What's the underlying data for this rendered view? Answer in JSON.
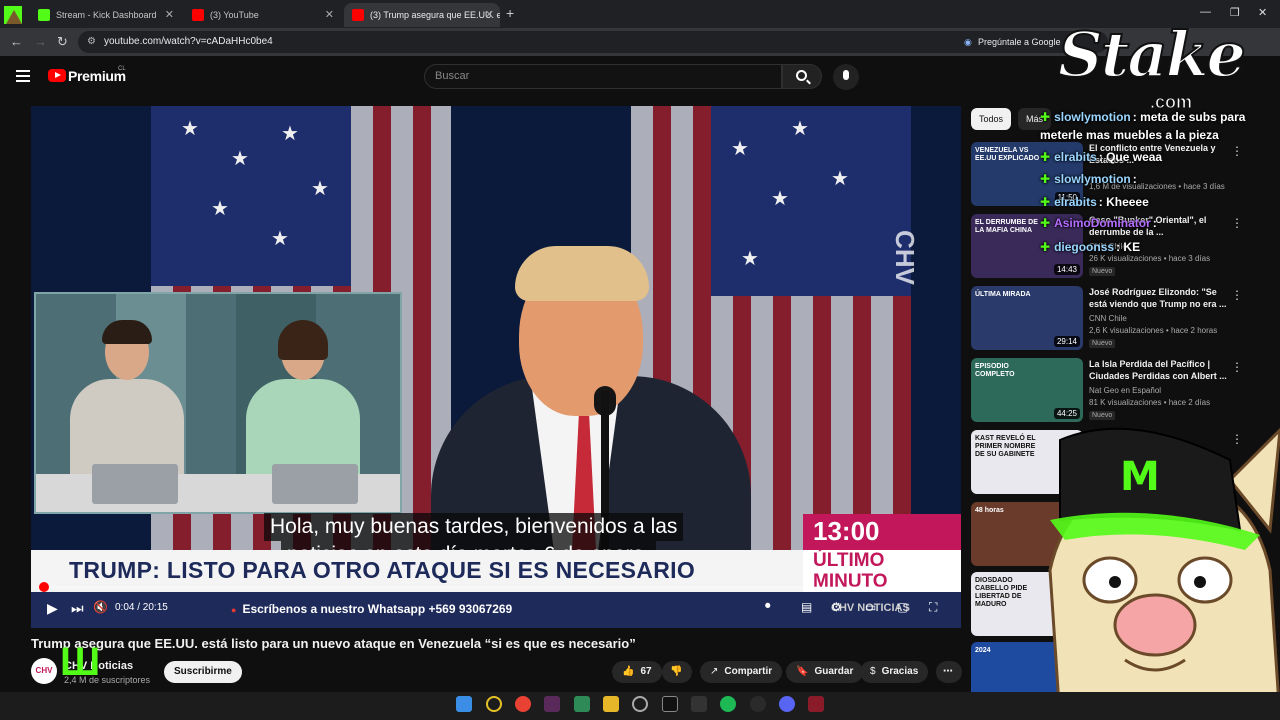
{
  "browser": {
    "tabs": [
      {
        "label": "Stream - Kick Dashboard",
        "active": false
      },
      {
        "label": "(3) YouTube",
        "active": false
      },
      {
        "label": "(3) Trump asegura que EE.UU. e",
        "active": true
      }
    ],
    "url": "youtube.com/watch?v=cADaHHc0be4",
    "google_button": "Pregúntale a Google"
  },
  "youtube": {
    "logo_text": "Premium",
    "country": "CL",
    "search_placeholder": "Buscar"
  },
  "video": {
    "subtitle_line1": "Hola, muy buenas tardes, bienvenidos a las",
    "subtitle_line2": "noticias en este día martes 6 de enero.",
    "headline": "TRUMP: LISTO PARA OTRO ATAQUE SI ES NECESARIO",
    "time": "13:00",
    "ultimo_minuto": "ÚLTIMO MINUTO",
    "whatsapp": "Escríbenos a nuestro Whatsapp +569 93067269",
    "network_mark": "CHV NOTICIAS",
    "timecode": "0:04 / 20:15",
    "progress": 0.003,
    "inset_logo": "CHV",
    "title": "Trump asegura que EE.UU. está listo para un nuevo ataque en Venezuela “si es que es necesario”",
    "channel": "CHV Noticias",
    "subscribers": "2,4 M de suscriptores",
    "subscribe_label": "Suscribirme",
    "likes": "67",
    "share": "Compartir",
    "save": "Guardar",
    "thanks": "Gracias"
  },
  "sidebar": {
    "chips": [
      "Todos",
      "Más"
    ],
    "recommendations": [
      {
        "title": "El conflicto entre Venezuela y Estados ...",
        "channel": "",
        "meta": "1,6 M de visualizaciones • hace 3 días",
        "new": "",
        "duration": "11:50",
        "thumb_text": "VENEZUELA VS EE.UU EXPLICADO",
        "color": "#243a6b"
      },
      {
        "title": "Caso \"Bunker\" Oriental\", el derrumbe de la ...",
        "channel": "CNN Chile",
        "meta": "26 K visualizaciones • hace 3 días",
        "new": "Nuevo",
        "duration": "14:43",
        "thumb_text": "EL DERRUMBE DE LA MAFIA CHINA",
        "color": "#3a2a5a"
      },
      {
        "title": "José Rodríguez Elizondo: \"Se está viendo que Trump no era ...",
        "channel": "CNN Chile",
        "meta": "2,6 K visualizaciones • hace 2 horas",
        "new": "Nuevo",
        "duration": "29:14",
        "thumb_text": "ÚLTIMA MIRADA",
        "color": "#2a3a6a"
      },
      {
        "title": "La Isla Perdida del Pacífico | Ciudades Perdidas con Albert ...",
        "channel": "Nat Geo en Español",
        "meta": "81 K visualizaciones • hace 2 días",
        "new": "Nuevo",
        "duration": "44:25",
        "thumb_text": "EPISODIO COMPLETO",
        "color": "#2e6a5a"
      },
      {
        "title": "",
        "channel": "",
        "meta": "",
        "new": "",
        "duration": "",
        "thumb_text": "KAST REVELÓ EL PRIMER NOMBRE DE SU GABINETE",
        "color": "#e8e8ee"
      },
      {
        "title": "",
        "channel": "",
        "meta": "",
        "new": "",
        "duration": "",
        "thumb_text": "48 horas",
        "color": "#6a3a2a"
      },
      {
        "title": "",
        "channel": "",
        "meta": "",
        "new": "",
        "duration": "",
        "thumb_text": "DIOSDADO CABELLO PIDE LIBERTAD DE MADURO",
        "color": "#e8e8ee"
      },
      {
        "title": "",
        "channel": "",
        "meta": "",
        "new": "",
        "duration": "",
        "thumb_text": "2024",
        "color": "#1e4aa0"
      }
    ]
  },
  "chat": [
    {
      "user": "slowlymotion",
      "text": ": meta de subs para"
    },
    {
      "user": "",
      "text": "meterle mas muebles a la pieza"
    },
    {
      "user": "elrabits",
      "text": ": Que weaa"
    },
    {
      "user": "slowlymotion",
      "text": ":"
    },
    {
      "user": "elrabits",
      "text": ": Kheeee"
    },
    {
      "user": "AsimoDominator",
      "text": ":"
    },
    {
      "user": "diegoonss",
      "text": ": KE"
    }
  ],
  "overlay": {
    "brand": "Stake",
    "brand_suffix": ".com"
  },
  "colors": {
    "kick_green": "#53fc18",
    "yt_red": "#ff0000",
    "chv_magenta": "#c2185b",
    "navy": "#1d2a5a"
  }
}
